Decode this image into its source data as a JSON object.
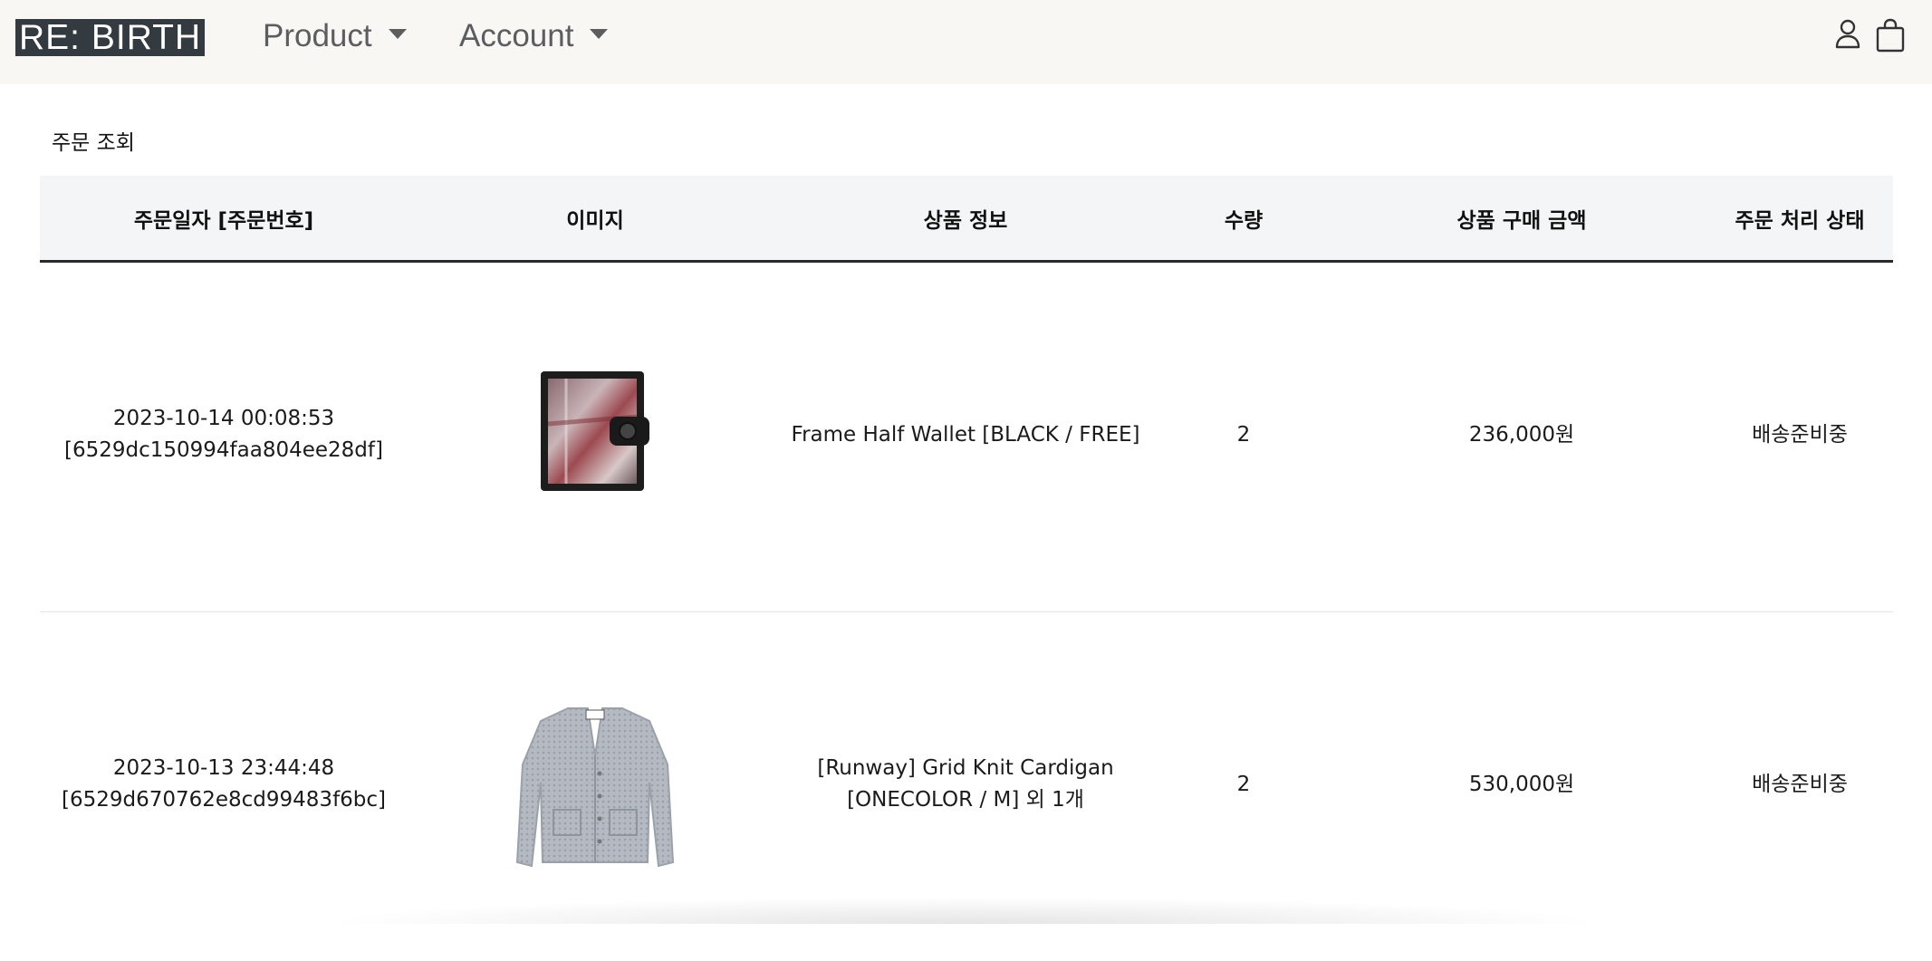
{
  "nav": {
    "logo": "RE: BIRTH",
    "product_label": "Product",
    "account_label": "Account"
  },
  "page": {
    "heading": "주문 조회"
  },
  "table": {
    "headers": [
      "주문일자 [주문번호]",
      "이미지",
      "상품 정보",
      "수량",
      "상품 구매 금액",
      "주문 처리 상태"
    ],
    "rows": [
      {
        "date": "2023-10-14 00:08:53",
        "order_no": "[6529dc150994faa804ee28df]",
        "product_line1": "Frame Half Wallet [BLACK / FREE]",
        "product_line2": "",
        "quantity": "2",
        "price": "236,000원",
        "status": "배송준비중",
        "image": "wallet"
      },
      {
        "date": "2023-10-13 23:44:48",
        "order_no": "[6529d670762e8cd99483f6bc]",
        "product_line1": "[Runway] Grid Knit Cardigan",
        "product_line2": "[ONECOLOR / M] 외 1개",
        "quantity": "2",
        "price": "530,000원",
        "status": "배송준비중",
        "image": "cardigan"
      }
    ]
  },
  "icons": {
    "user": "user-icon",
    "cart": "shopping-bag-icon"
  },
  "colors": {
    "navbar_bg": "#f8f7f4",
    "logo_bg": "#333a40",
    "header_bg": "#f4f5f6"
  }
}
